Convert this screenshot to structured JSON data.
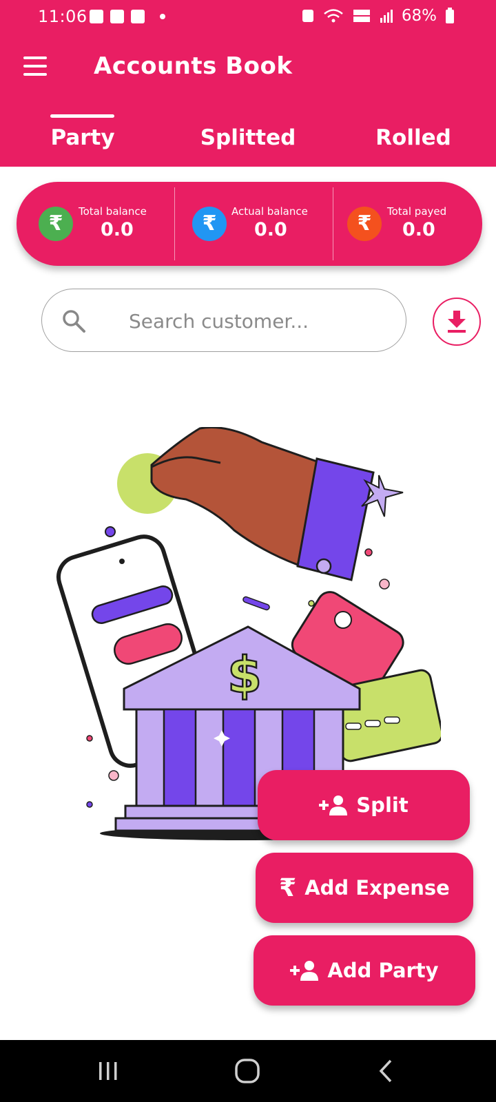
{
  "status_bar": {
    "time": "11:06",
    "battery": "68%",
    "icons": [
      "gallery-icon",
      "linkedin-icon",
      "media-icon",
      "notification-dot",
      "sync-icon",
      "wifi-icon",
      "volte-icon",
      "signal-icon",
      "battery-icon"
    ]
  },
  "app_bar": {
    "title": "Accounts Book",
    "menu_icon": "hamburger-menu-icon"
  },
  "tabs": [
    {
      "label": "Party",
      "selected": true
    },
    {
      "label": "Splitted",
      "selected": false
    },
    {
      "label": "Rolled",
      "selected": false
    }
  ],
  "summary": [
    {
      "label": "Total balance",
      "value": "0.0",
      "color": "#4CAF50"
    },
    {
      "label": "Actual balance",
      "value": "0.0",
      "color": "#2196F3"
    },
    {
      "label": "Total payed",
      "value": "0.0",
      "color": "#F4511E"
    }
  ],
  "search": {
    "placeholder": "Search customer..."
  },
  "actions": {
    "split": "Split",
    "add_expense": "Add Expense",
    "add_party": "Add Party"
  },
  "theme": {
    "primary": "#E91E63"
  }
}
